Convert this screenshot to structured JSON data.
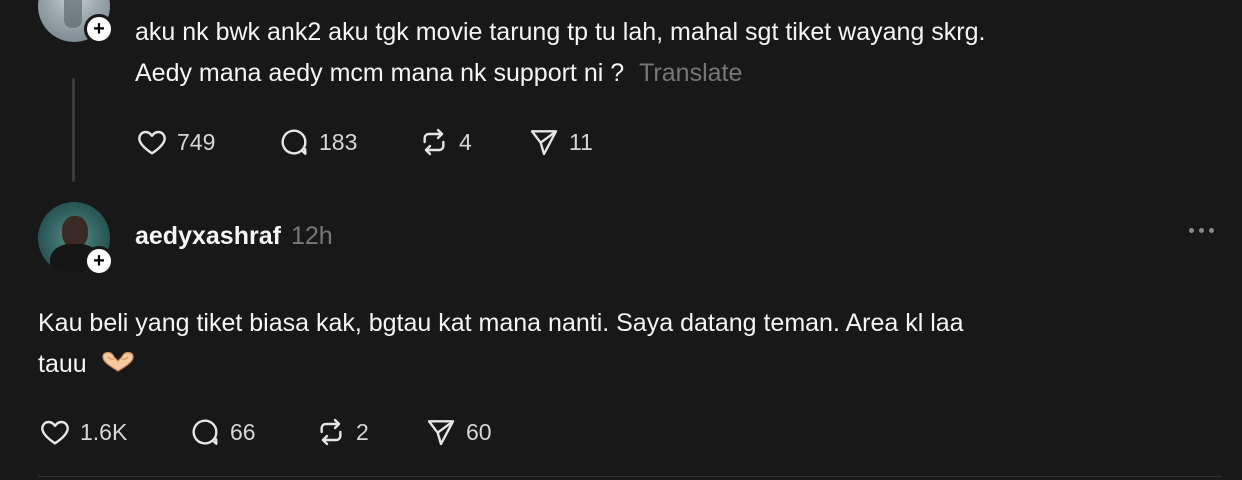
{
  "post1": {
    "text_line1": "aku nk bwk ank2 aku tgk movie tarung tp tu lah, mahal sgt tiket wayang skrg.",
    "text_line2": "Aedy mana aedy mcm mana nk support ni ?",
    "translate_label": "Translate",
    "likes": "749",
    "replies": "183",
    "reposts": "4",
    "shares": "11"
  },
  "post2": {
    "username": "aedyxashraf",
    "time": "12h",
    "text_line1": "Kau beli yang tiket biasa kak, bgtau kat mana nanti. Saya datang teman. Area kl laa",
    "text_line2": "tauu",
    "emoji": "heart-hands",
    "likes": "1.6K",
    "replies": "66",
    "reposts": "2",
    "shares": "60"
  },
  "icons": {
    "like": "heart-icon",
    "reply": "comment-icon",
    "repost": "repost-icon",
    "share": "share-icon",
    "follow": "plus-icon",
    "more": "more-icon"
  },
  "colors": {
    "background": "#181818",
    "text": "#f3f5f7",
    "muted": "#777777"
  }
}
